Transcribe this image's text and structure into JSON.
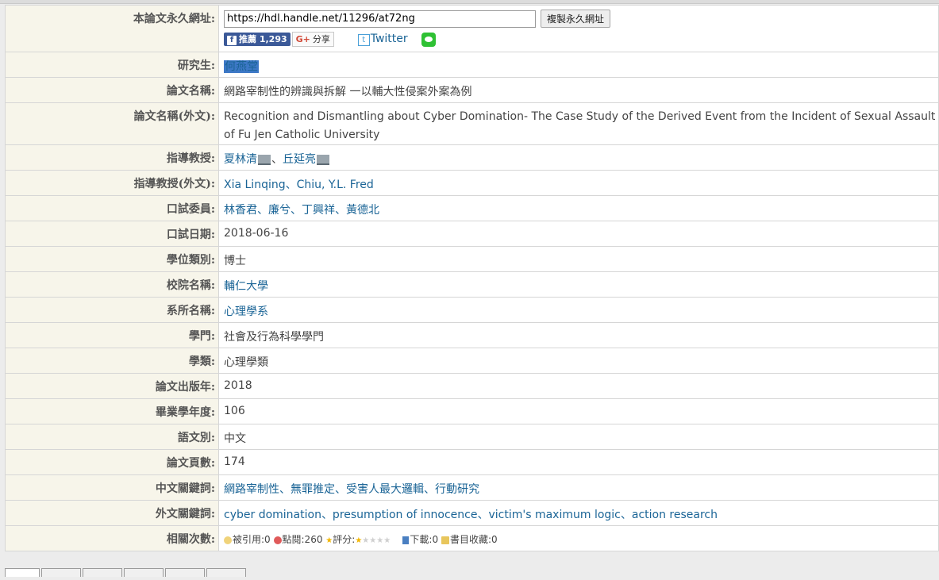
{
  "labels": {
    "permalink": "本論文永久網址:",
    "student": "研究生:",
    "title": "論文名稱:",
    "title_en": "論文名稱(外文):",
    "advisor": "指導教授:",
    "advisor_en": "指導教授(外文):",
    "committee": "口試委員:",
    "oral_date": "口試日期:",
    "degree": "學位類別:",
    "school": "校院名稱:",
    "department": "系所名稱:",
    "discipline": "學門:",
    "field": "學類:",
    "pub_year": "論文出版年:",
    "grad_year": "畢業學年度:",
    "language": "語文別:",
    "pages": "論文頁數:",
    "keywords_zh": "中文關鍵詞:",
    "keywords_en": "外文關鍵詞:",
    "stats": "相關次數:"
  },
  "permalink": {
    "url": "https://hdl.handle.net/11296/at72ng",
    "copy_label": "複製永久網址",
    "fb_label": "推薦 1,293",
    "gplus_label": "分享",
    "twitter_label": "Twitter"
  },
  "values": {
    "student": "何燕堂",
    "title": "網路宰制性的辨識與拆解 一以輔大性侵案外案為例",
    "title_en": "Recognition and Dismantling about Cyber Domination- The Case Study of the Derived Event from the Incident of Sexual Assault of Fu Jen Catholic University",
    "advisors": [
      "夏林清",
      "丘延亮"
    ],
    "advisor_sep": "、",
    "advisor_en": "Xia Linqing、Chiu, Y.L. Fred",
    "committee": "林香君、廉兮、丁興祥、黃德北",
    "oral_date": "2018-06-16",
    "degree": "博士",
    "school": "輔仁大學",
    "department": "心理學系",
    "discipline": "社會及行為科學學門",
    "field": "心理學類",
    "pub_year": "2018",
    "grad_year": "106",
    "language": "中文",
    "pages": "174",
    "keywords_zh": "網路宰制性、無罪推定、受害人最大邏輯、行動研究",
    "keywords_en": "cyber domination、presumption of innocence、victim's maximum logic、action research"
  },
  "stats": {
    "cited": "被引用:0",
    "views": "點閱:260",
    "rating": "評分:",
    "rating_value": 1,
    "rating_max": 5,
    "downloads": "下載:0",
    "bookmarks": "書目收藏:0"
  },
  "colors": {
    "label_bg": "#f7f5ea",
    "link": "#1a6496",
    "highlight": "#3d78c6"
  }
}
